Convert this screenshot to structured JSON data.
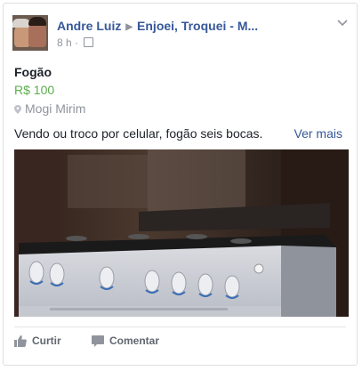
{
  "post": {
    "author": "Andre Luiz",
    "group": "Enjoei, Troquei - M...",
    "time": "8 h",
    "separator": "·"
  },
  "listing": {
    "title": "Fogão",
    "price": "R$ 100",
    "location": "Mogi Mirim",
    "description": "Vendo ou troco por celular, fogão seis bocas.",
    "see_more": "Ver mais"
  },
  "actions": {
    "like": "Curtir",
    "comment": "Comentar"
  },
  "icons": {
    "options": "chevron-down-icon",
    "audience": "group-icon",
    "location": "map-pin-icon",
    "like": "thumbs-up-icon",
    "comment": "comment-icon"
  },
  "colors": {
    "link": "#365899",
    "price": "#5bae4b",
    "muted": "#90949c",
    "text": "#1d2129"
  }
}
